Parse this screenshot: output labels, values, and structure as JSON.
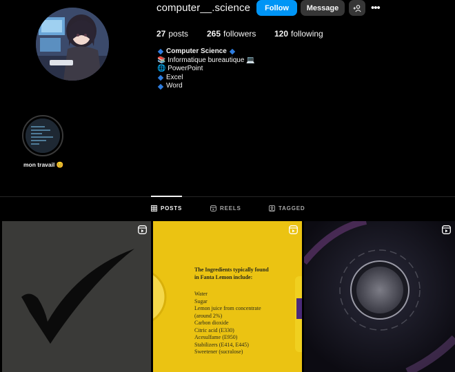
{
  "profile": {
    "username": "computer__.science",
    "follow_label": "Follow",
    "message_label": "Message",
    "more_label": "•••",
    "stats": [
      {
        "value": "27",
        "label": "posts"
      },
      {
        "value": "265",
        "label": "followers"
      },
      {
        "value": "120",
        "label": "following"
      }
    ],
    "bio": {
      "name": "Computer Science",
      "lines": [
        "📚 Informatique bureautique 💻",
        "🌐 PowerPoint",
        "Excel",
        "Word"
      ]
    }
  },
  "highlight": {
    "label": "mon travail 😊"
  },
  "tabs": [
    {
      "label": "POSTS",
      "icon": "grid-icon",
      "active": true
    },
    {
      "label": "REELS",
      "icon": "reels-icon",
      "active": false
    },
    {
      "label": "TAGGED",
      "icon": "tagged-icon",
      "active": false
    }
  ],
  "posts": [
    {
      "kind": "reel",
      "icon": "checkmark-image"
    },
    {
      "kind": "reel",
      "title": "The Ingredients typically found in Fanta Lemon include:",
      "ingredients": [
        "Water",
        "Sugar",
        "Lemon juice from concentrate (around 2%)",
        "Carbon dioxide",
        "Citric acid (E330)",
        "Acesulfame (E950)",
        "Stabilizers (E414, E445)",
        "Sweetener (sucralose)"
      ]
    },
    {
      "kind": "reel",
      "icon": "circle-image"
    }
  ],
  "colors": {
    "accent": "#0095f6",
    "button_dark": "#363636",
    "background": "#000000"
  }
}
